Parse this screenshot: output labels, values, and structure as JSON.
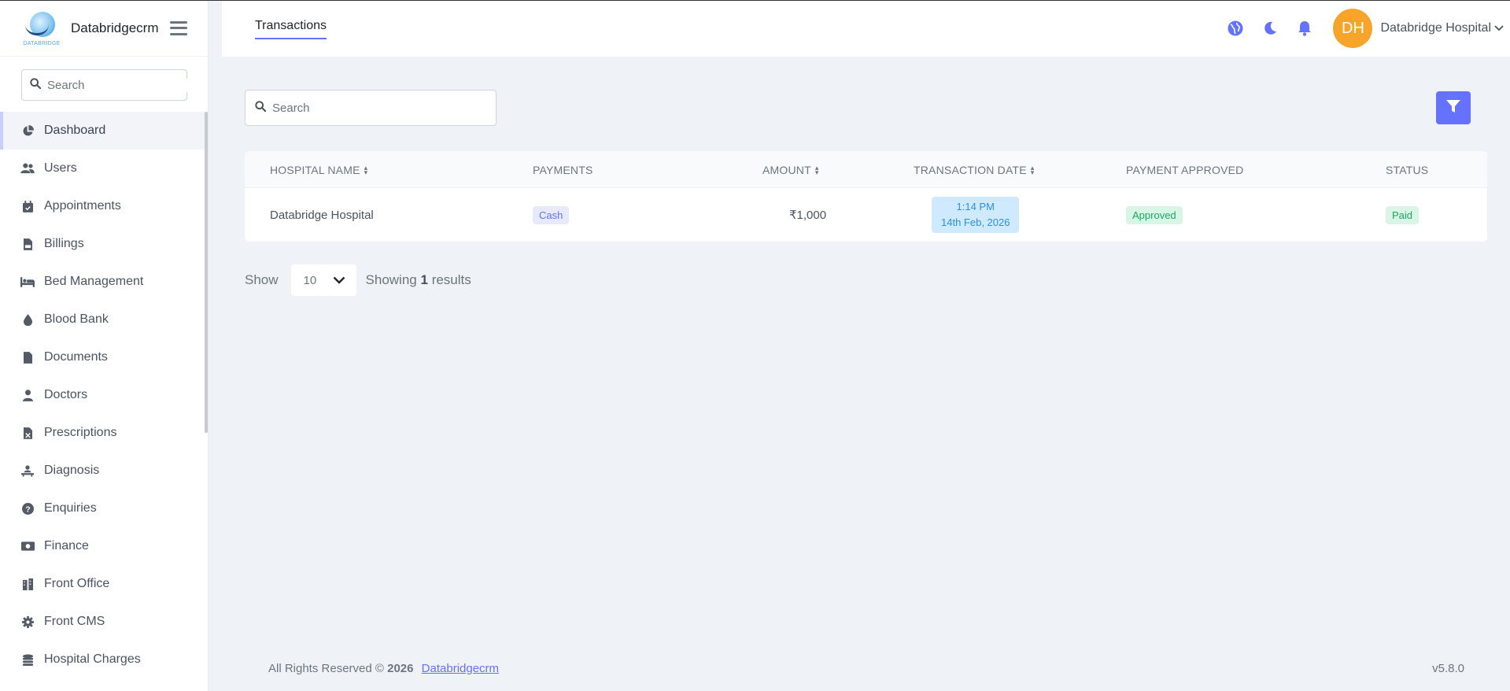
{
  "brand": {
    "name": "Databridgecrm",
    "logo_text": "DATABRIDGE"
  },
  "sidebar": {
    "search_placeholder": "Search",
    "items": [
      {
        "label": "Dashboard",
        "icon": "pie-chart-icon"
      },
      {
        "label": "Users",
        "icon": "users-icon"
      },
      {
        "label": "Appointments",
        "icon": "calendar-check-icon"
      },
      {
        "label": "Billings",
        "icon": "file-invoice-icon"
      },
      {
        "label": "Bed Management",
        "icon": "bed-icon"
      },
      {
        "label": "Blood Bank",
        "icon": "droplet-icon"
      },
      {
        "label": "Documents",
        "icon": "file-icon"
      },
      {
        "label": "Doctors",
        "icon": "user-doctor-icon"
      },
      {
        "label": "Prescriptions",
        "icon": "prescription-icon"
      },
      {
        "label": "Diagnosis",
        "icon": "person-diagnosis-icon"
      },
      {
        "label": "Enquiries",
        "icon": "question-circle-icon"
      },
      {
        "label": "Finance",
        "icon": "money-bill-icon"
      },
      {
        "label": "Front Office",
        "icon": "building-icon"
      },
      {
        "label": "Front CMS",
        "icon": "gear-icon"
      },
      {
        "label": "Hospital Charges",
        "icon": "coins-icon"
      }
    ]
  },
  "header": {
    "tab": "Transactions",
    "avatar_initials": "DH",
    "user_name": "Databridge Hospital",
    "accent": "#6571ff",
    "avatar_color": "#f7a52a"
  },
  "search": {
    "placeholder": "Search"
  },
  "table": {
    "columns": {
      "hospital_name": "HOSPITAL NAME",
      "payments": "PAYMENTS",
      "amount": "AMOUNT",
      "transaction_date": "TRANSACTION DATE",
      "payment_approved": "PAYMENT APPROVED",
      "status": "STATUS"
    },
    "rows": [
      {
        "hospital_name": "Databridge Hospital",
        "payment": "Cash",
        "amount": "₹1,000",
        "time": "1:14 PM",
        "date": "14th Feb, 2026",
        "approved": "Approved",
        "status": "Paid"
      }
    ]
  },
  "pager": {
    "show_label": "Show",
    "per_page": "10",
    "showing_prefix": "Showing",
    "count": "1",
    "showing_suffix": "results"
  },
  "footer": {
    "rights": "All Rights Reserved ©",
    "year": "2026",
    "link": "Databridgecrm",
    "version": "v5.8.0"
  }
}
